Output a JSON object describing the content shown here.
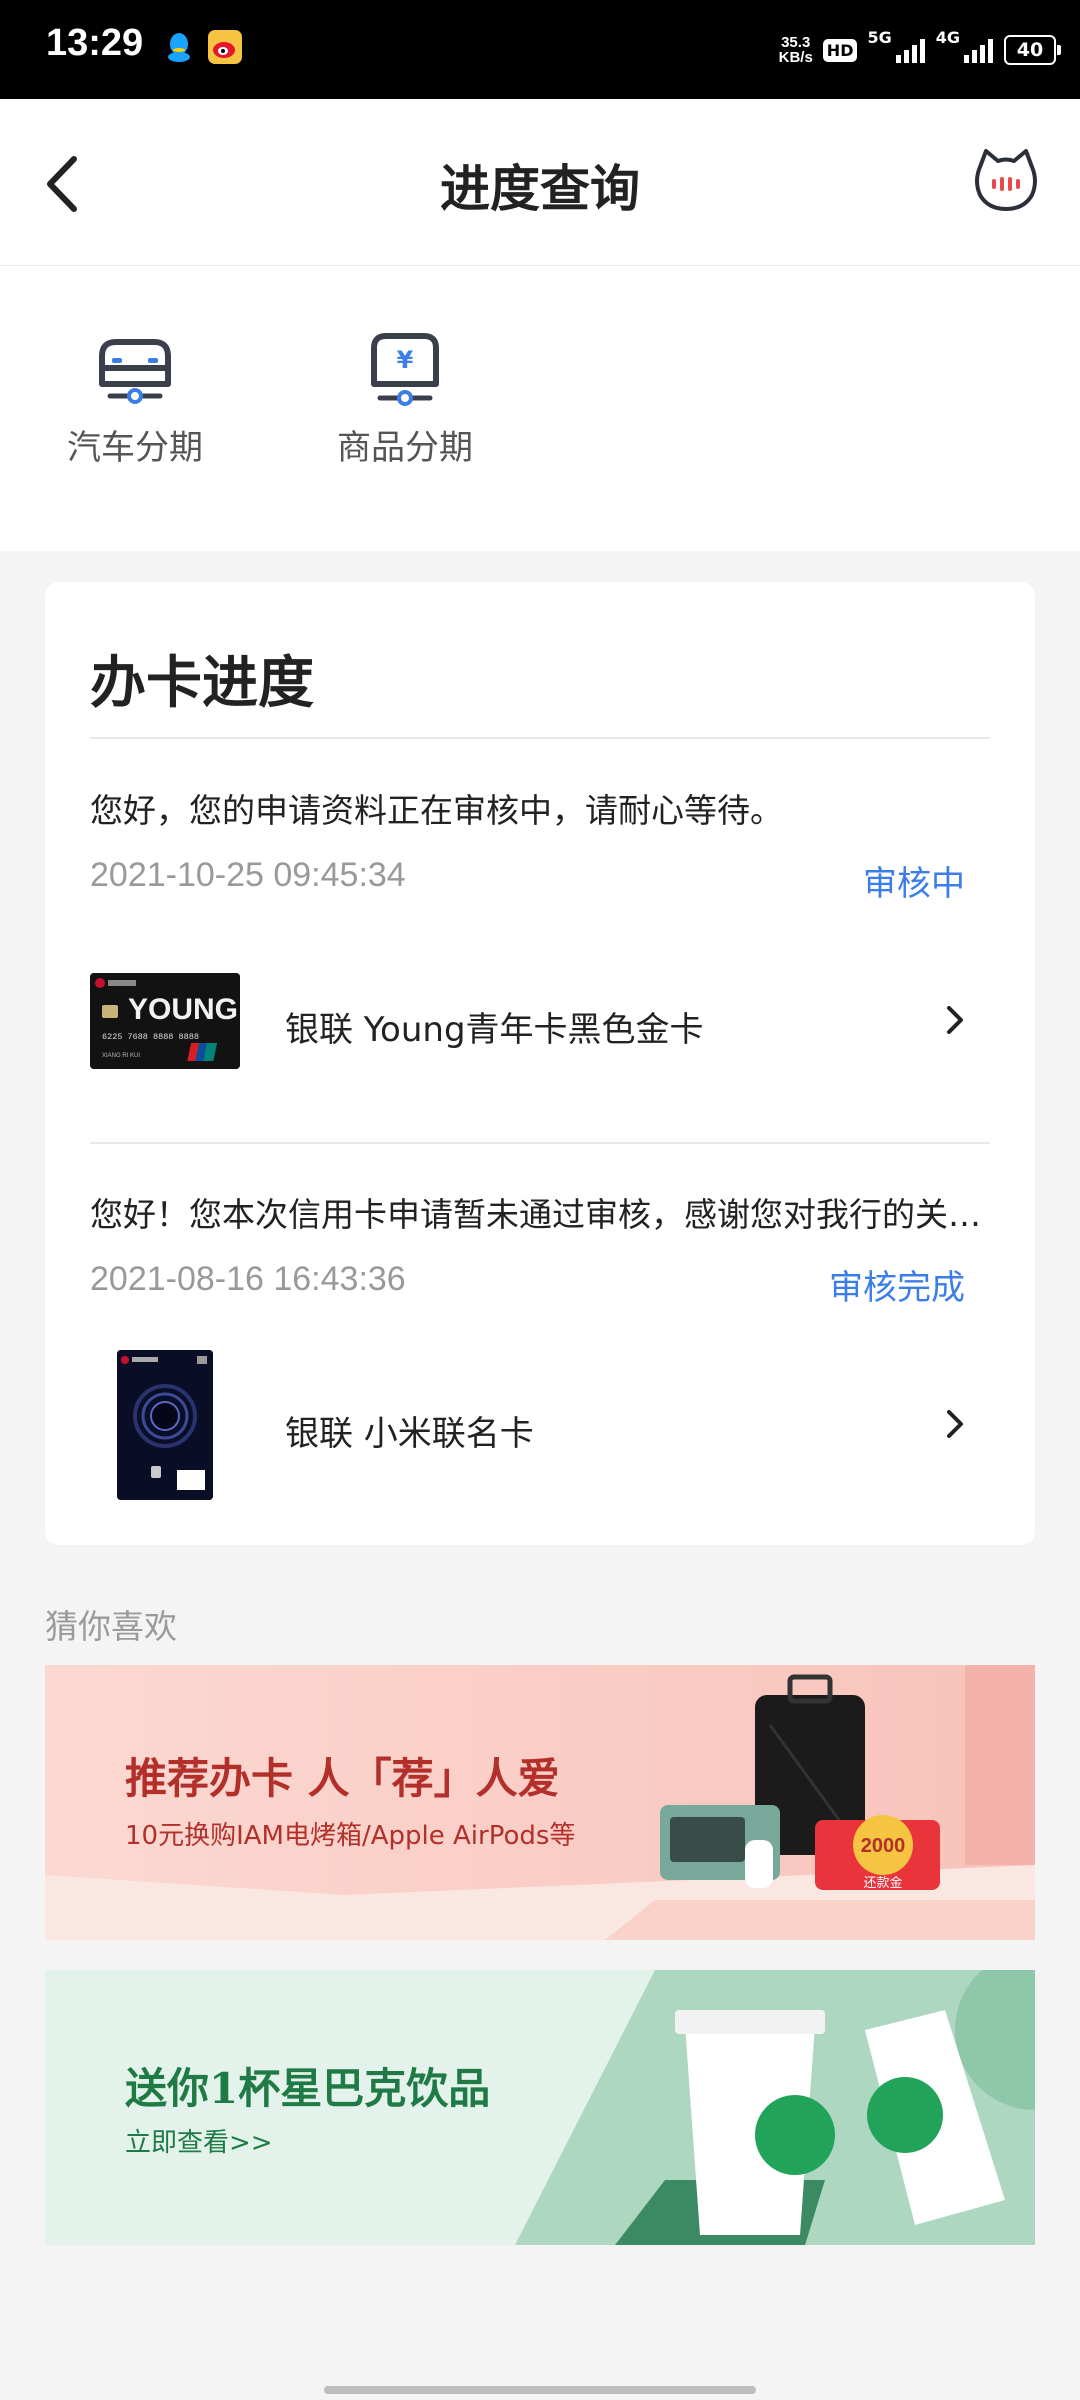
{
  "status_bar": {
    "time": "13:29",
    "net_speed_value": "35.3",
    "net_speed_unit": "KB/s",
    "hd": "HD",
    "sim1": "5G",
    "sim2": "4G",
    "battery": "40"
  },
  "header": {
    "title": "进度查询",
    "back_icon": "chevron-left-icon",
    "right_icon": "cat-mascot-icon"
  },
  "quick_entries": [
    {
      "label": "汽车分期",
      "icon": "car-icon"
    },
    {
      "label": "商品分期",
      "icon": "goods-yen-icon"
    }
  ],
  "progress": {
    "title": "办卡进度",
    "applications": [
      {
        "message": "您好，您的申请资料正在审核中，请耐心等待。",
        "time": "2021-10-25 09:45:34",
        "status": "审核中",
        "card_name": "银联 Young青年卡黑色金卡",
        "card_art_text": "YOUNG",
        "card_art_number": "6225 7688 8888 8888",
        "card_art_holder": "XIANG RI KUI"
      },
      {
        "message": "您好！您本次信用卡申请暂未通过审核，感谢您对我行的关注与支持。",
        "time": "2021-08-16 16:43:36",
        "status": "审核完成",
        "card_name": "银联 小米联名卡"
      }
    ]
  },
  "recommend": {
    "title": "猜你喜欢",
    "banners": [
      {
        "heading": "推荐办卡  人「荐」人爱",
        "sub": "10元换购IAM电烤箱/Apple AirPods等",
        "badge_amount": "2000",
        "badge_label": "还款金"
      },
      {
        "heading": "送你1杯星巴克饮品",
        "sub": "立即查看>>"
      }
    ]
  },
  "colors": {
    "accent": "#3b7ee8",
    "icon_dark": "#3a3f4b",
    "icon_blue": "#3b7ee8",
    "referral_text": "#b3302a",
    "starbucks_green": "#1f7a45"
  }
}
